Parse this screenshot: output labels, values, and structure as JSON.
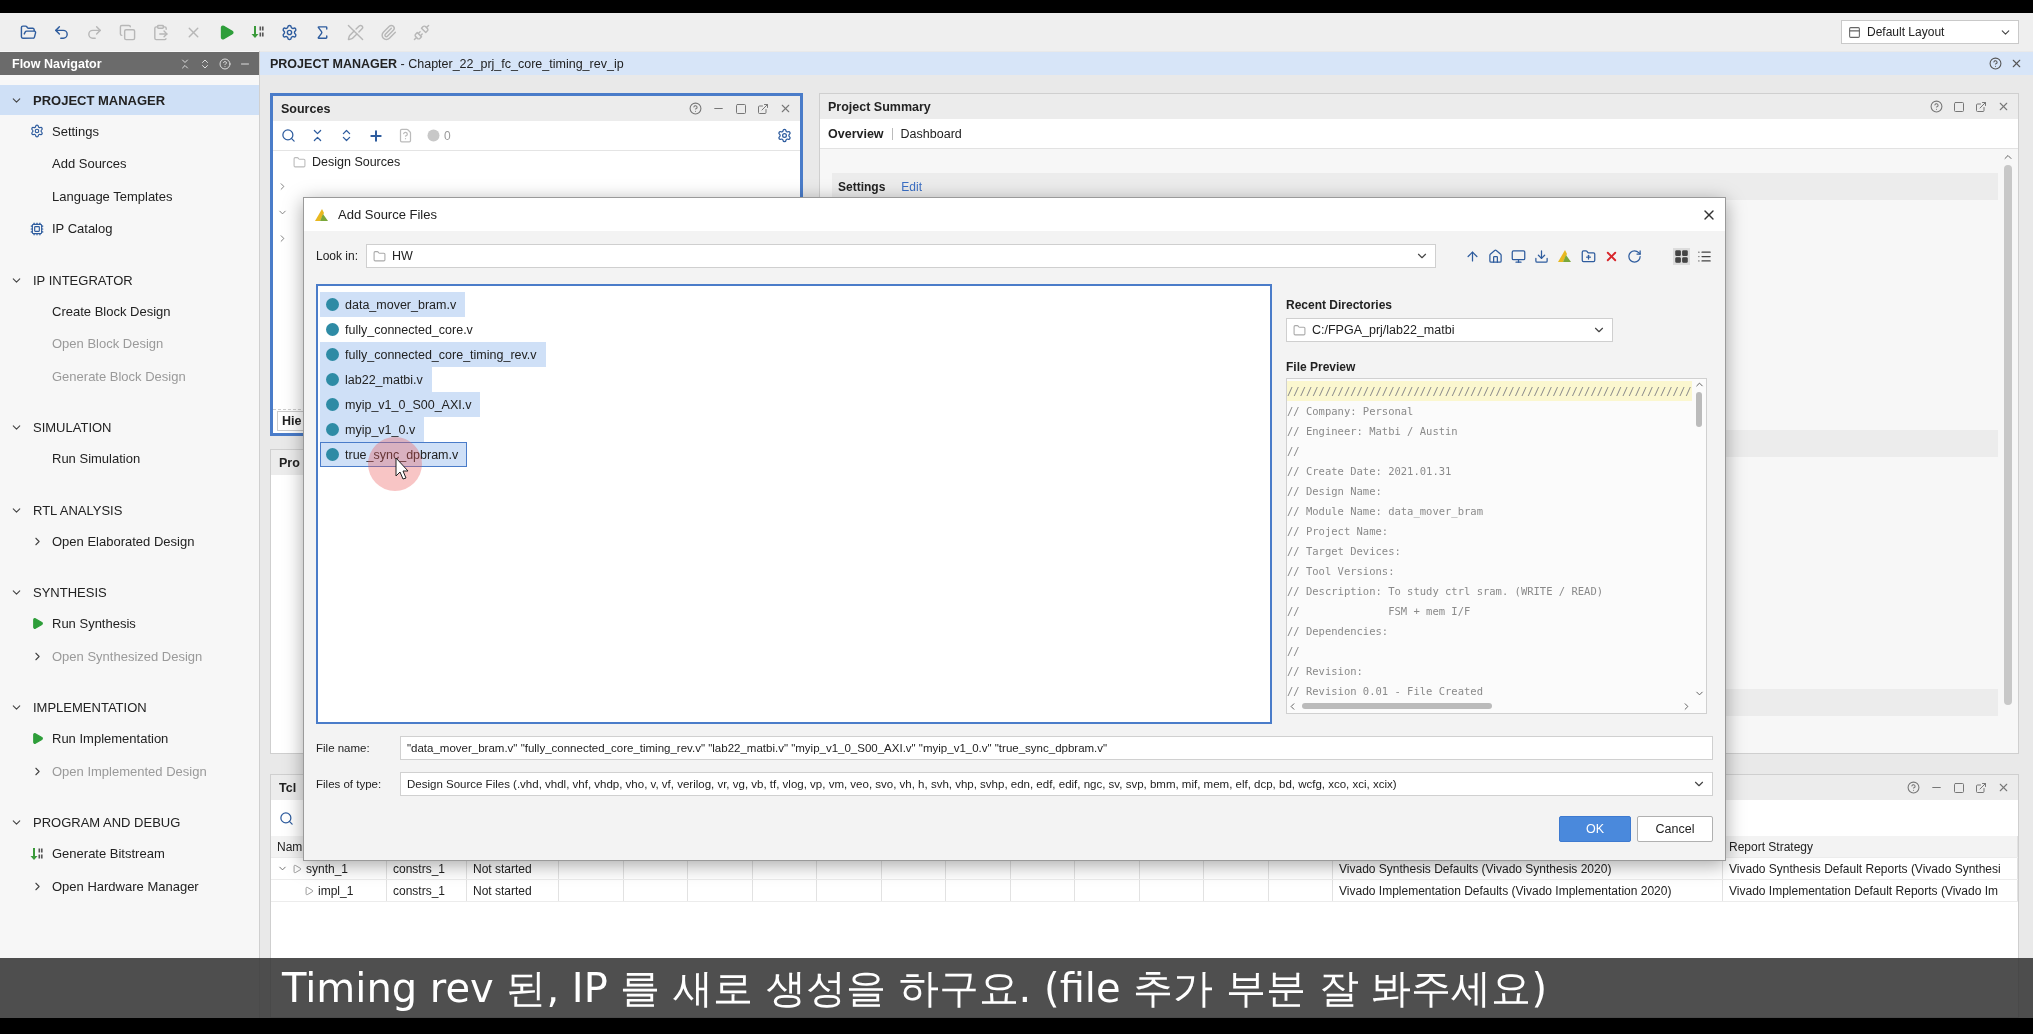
{
  "toolbar": {
    "buttons": [
      {
        "kind": "open",
        "disabled": false
      },
      {
        "kind": "undo",
        "disabled": false
      },
      {
        "kind": "redo",
        "disabled": true
      },
      {
        "kind": "copy",
        "disabled": true
      },
      {
        "kind": "paste",
        "disabled": true
      },
      {
        "kind": "delete",
        "disabled": true
      },
      {
        "kind": "run",
        "disabled": false
      },
      {
        "kind": "bitstream",
        "disabled": false
      },
      {
        "kind": "settings",
        "disabled": false
      },
      {
        "kind": "sigma",
        "disabled": false
      },
      {
        "kind": "pen-off",
        "disabled": true
      },
      {
        "kind": "clip",
        "disabled": true
      },
      {
        "kind": "unplug",
        "disabled": true
      }
    ],
    "layout_menu": "Default Layout"
  },
  "flow_navigator": {
    "title": "Flow Navigator",
    "sections": [
      {
        "title": "PROJECT MANAGER",
        "expanded": true,
        "selected": true,
        "items": [
          {
            "label": "Settings",
            "kind": "settings",
            "disabled": false
          },
          {
            "label": "Add Sources",
            "kind": "link",
            "disabled": false
          },
          {
            "label": "Language Templates",
            "kind": "link",
            "disabled": false
          },
          {
            "label": "IP Catalog",
            "kind": "catalog",
            "disabled": false
          }
        ]
      },
      {
        "title": "IP INTEGRATOR",
        "expanded": true,
        "selected": false,
        "items": [
          {
            "label": "Create Block Design",
            "kind": "link",
            "disabled": false
          },
          {
            "label": "Open Block Design",
            "kind": "link",
            "disabled": true
          },
          {
            "label": "Generate Block Design",
            "kind": "link",
            "disabled": true
          }
        ]
      },
      {
        "title": "SIMULATION",
        "expanded": true,
        "selected": false,
        "items": [
          {
            "label": "Run Simulation",
            "kind": "link",
            "disabled": false
          }
        ]
      },
      {
        "title": "RTL ANALYSIS",
        "expanded": true,
        "selected": false,
        "items": [
          {
            "label": "Open Elaborated Design",
            "kind": "expander",
            "disabled": false
          }
        ]
      },
      {
        "title": "SYNTHESIS",
        "expanded": true,
        "selected": false,
        "items": [
          {
            "label": "Run Synthesis",
            "kind": "run",
            "disabled": false
          },
          {
            "label": "Open Synthesized Design",
            "kind": "expander",
            "disabled": true
          }
        ]
      },
      {
        "title": "IMPLEMENTATION",
        "expanded": true,
        "selected": false,
        "items": [
          {
            "label": "Run Implementation",
            "kind": "run",
            "disabled": false
          },
          {
            "label": "Open Implemented Design",
            "kind": "expander",
            "disabled": true
          }
        ]
      },
      {
        "title": "PROGRAM AND DEBUG",
        "expanded": true,
        "selected": false,
        "items": [
          {
            "label": "Generate Bitstream",
            "kind": "bitstream",
            "disabled": false
          },
          {
            "label": "Open Hardware Manager",
            "kind": "expander",
            "disabled": false
          }
        ]
      }
    ]
  },
  "page_header": {
    "title": "**PROJECT MANAGER** - Chapter_22_prj_fc_core_timing_rev_ip"
  },
  "sources": {
    "title": "Sources",
    "count": "0",
    "tree": [
      {
        "label": "Design Sources"
      }
    ],
    "tab": "Hie"
  },
  "properties": {
    "title": "Pro"
  },
  "project_summary": {
    "title": "Project Summary",
    "tabs": [
      {
        "label": "Overview",
        "selected": true
      },
      {
        "label": "Dashboard",
        "selected": false
      }
    ],
    "settings": {
      "label": "Settings",
      "link": "Edit"
    }
  },
  "runs_panel": {
    "title": "Tcl",
    "columns": [
      {
        "label": "Nam"
      },
      {},
      {},
      {},
      {
        "label": "Report Strategy"
      }
    ],
    "rows": [
      {
        "name": "synth_1",
        "expanded": true,
        "cells": [
          "constrs_1",
          "Not started",
          "Vivado Synthesis Defaults (Vivado Synthesis 2020)",
          "Vivado Synthesis Default Reports (Vivado Synthesi"
        ],
        "children": [
          {
            "name": "impl_1",
            "cells": [
              "constrs_1",
              "Not started",
              "Vivado Implementation Defaults (Vivado Implementation 2020)",
              "Vivado Implementation Default Reports (Vivado Im"
            ]
          }
        ]
      }
    ]
  },
  "dialog": {
    "title": "Add Source Files",
    "look_in": {
      "label": "Look in:",
      "value": "HW"
    },
    "tools": [
      {
        "kind": "up"
      },
      {
        "kind": "home"
      },
      {
        "kind": "desktop"
      },
      {
        "kind": "download"
      },
      {
        "kind": "logo"
      },
      {
        "kind": "new-folder"
      },
      {
        "kind": "delete"
      },
      {
        "kind": "refresh"
      },
      {
        "kind": "grid",
        "selected": true
      },
      {
        "kind": "list",
        "selected": false
      }
    ],
    "files": [
      {
        "name": "data_mover_bram.v",
        "selected": true,
        "focused": false
      },
      {
        "name": "fully_connected_core.v",
        "selected": false,
        "focused": false
      },
      {
        "name": "fully_connected_core_timing_rev.v",
        "selected": true,
        "focused": false
      },
      {
        "name": "lab22_matbi.v",
        "selected": true,
        "focused": false
      },
      {
        "name": "myip_v1_0_S00_AXI.v",
        "selected": true,
        "focused": false
      },
      {
        "name": "myip_v1_0.v",
        "selected": true,
        "focused": false
      },
      {
        "name": "true_sync_dpbram.v",
        "selected": true,
        "focused": true
      }
    ],
    "recent": {
      "label": "Recent Directories",
      "value": "C:/FPGA_prj/lab22_matbi"
    },
    "preview": {
      "label": "File Preview",
      "lines": [
        "////////////////////////////////////////////////////////////////",
        "// Company: Personal",
        "// Engineer: Matbi / Austin",
        "//",
        "// Create Date: 2021.01.31",
        "// Design Name:",
        "// Module Name: data_mover_bram",
        "// Project Name:",
        "// Target Devices:",
        "// Tool Versions:",
        "// Description: To study ctrl sram. (WRITE / READ)",
        "//              FSM + mem I/F",
        "// Dependencies:",
        "//",
        "// Revision:",
        "// Revision 0.01 - File Created"
      ]
    },
    "file_name": {
      "label": "File name:",
      "value": "\"data_mover_bram.v\" \"fully_connected_core_timing_rev.v\" \"lab22_matbi.v\" \"myip_v1_0_S00_AXI.v\" \"myip_v1_0.v\" \"true_sync_dpbram.v\""
    },
    "file_type": {
      "label": "Files of type:",
      "value": "Design Source Files (.vhd, vhdl, vhf, vhdp, vho, v, vf, verilog, vr, vg, vb, tf, vlog, vp, vm, veo, svo, vh, h, svh, vhp, svhp, edn, edf, edif, ngc, sv, svp, bmm, mif, mem, elf, dcp, bd, wcfg, xco, xci, xcix)"
    },
    "buttons": [
      {
        "label": "OK",
        "kind": "primary"
      },
      {
        "label": "Cancel",
        "kind": "secondary"
      }
    ]
  },
  "subtitle": "Timing rev 된, IP 를 새로 생성을 하구요. (file 추가 부분 잘 봐주세요)"
}
